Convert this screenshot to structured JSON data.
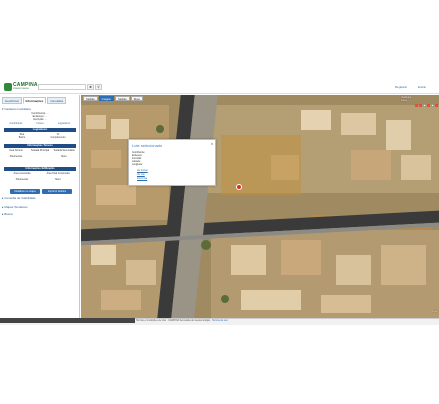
{
  "header": {
    "logo_text": "CAMPINA",
    "logo_sub": "PREFEITURA DE",
    "search_placeholder": "",
    "search_btn": "✖",
    "search_icon_btn": "⚲",
    "register_link": "Registrar",
    "login_link": "Entrar"
  },
  "left_panel": {
    "tabs": [
      {
        "label": "GeoPortal",
        "active": false
      },
      {
        "label": "Informações",
        "active": true
      },
      {
        "label": "Camadas",
        "active": false
      }
    ],
    "cadastro_title": "▾ Cadastro Imobiliário",
    "owner_line": "Contribuinte: ...",
    "address_line": "Endereço: ...",
    "inscricao_line": "Inscrição: ...",
    "links": [
      "Contribuinte",
      "Imóvel",
      "Logradouro"
    ],
    "section_logradouro": "Logradouro",
    "logradouro_rows": [
      [
        "Rua",
        "Nº"
      ],
      [
        "Bairro",
        "Complemento"
      ]
    ],
    "section_info_terreno": "Informações Terreno",
    "terreno_rows": [
      [
        "Área Terreno",
        "Testada Principal",
        "Testada Secundária"
      ],
      [
        "",
        "",
        ""
      ],
      [
        "Pavimentos",
        "",
        "Muro"
      ]
    ],
    "section_info_edificacao": "Informações Edificação",
    "edificacao_rows": [
      [
        "Área construída",
        "Área Total Construída"
      ],
      [
        "",
        ""
      ],
      [
        "Pavimentos",
        "Muro"
      ]
    ],
    "btn_left": "Detalhes no mapa",
    "btn_right": "Imprimir boletim",
    "collapsed": [
      "▸ Consulta de Viabilidade",
      "▸ Mapas Temáticos",
      "▸ Busca"
    ]
  },
  "map": {
    "toolbar": [
      {
        "label": "Satélite",
        "active": false
      },
      {
        "label": "Imagem",
        "active": true
      },
      {
        "label": "Satélite",
        "active": false
      },
      {
        "label": "Ruas",
        "active": false
      }
    ],
    "right_controls": [
      "Unidades",
      "Lotes",
      "Edificações",
      "Quadras"
    ],
    "popup": {
      "title": "Lote selecionado",
      "close": "x",
      "lines": [
        "Contribuinte:",
        "Endereço:",
        "Inscrição:",
        "Latitude:",
        "Longitude:"
      ],
      "links": [
        "Ver imóvel",
        "Ver lote",
        "Zoom lote"
      ]
    },
    "scale_text": "10 m"
  },
  "footer": {
    "url": "",
    "text": "Termos e Condições de Uso · CAMPINA Secretaria de Geotecnologia · ",
    "link": "Termos de uso"
  }
}
